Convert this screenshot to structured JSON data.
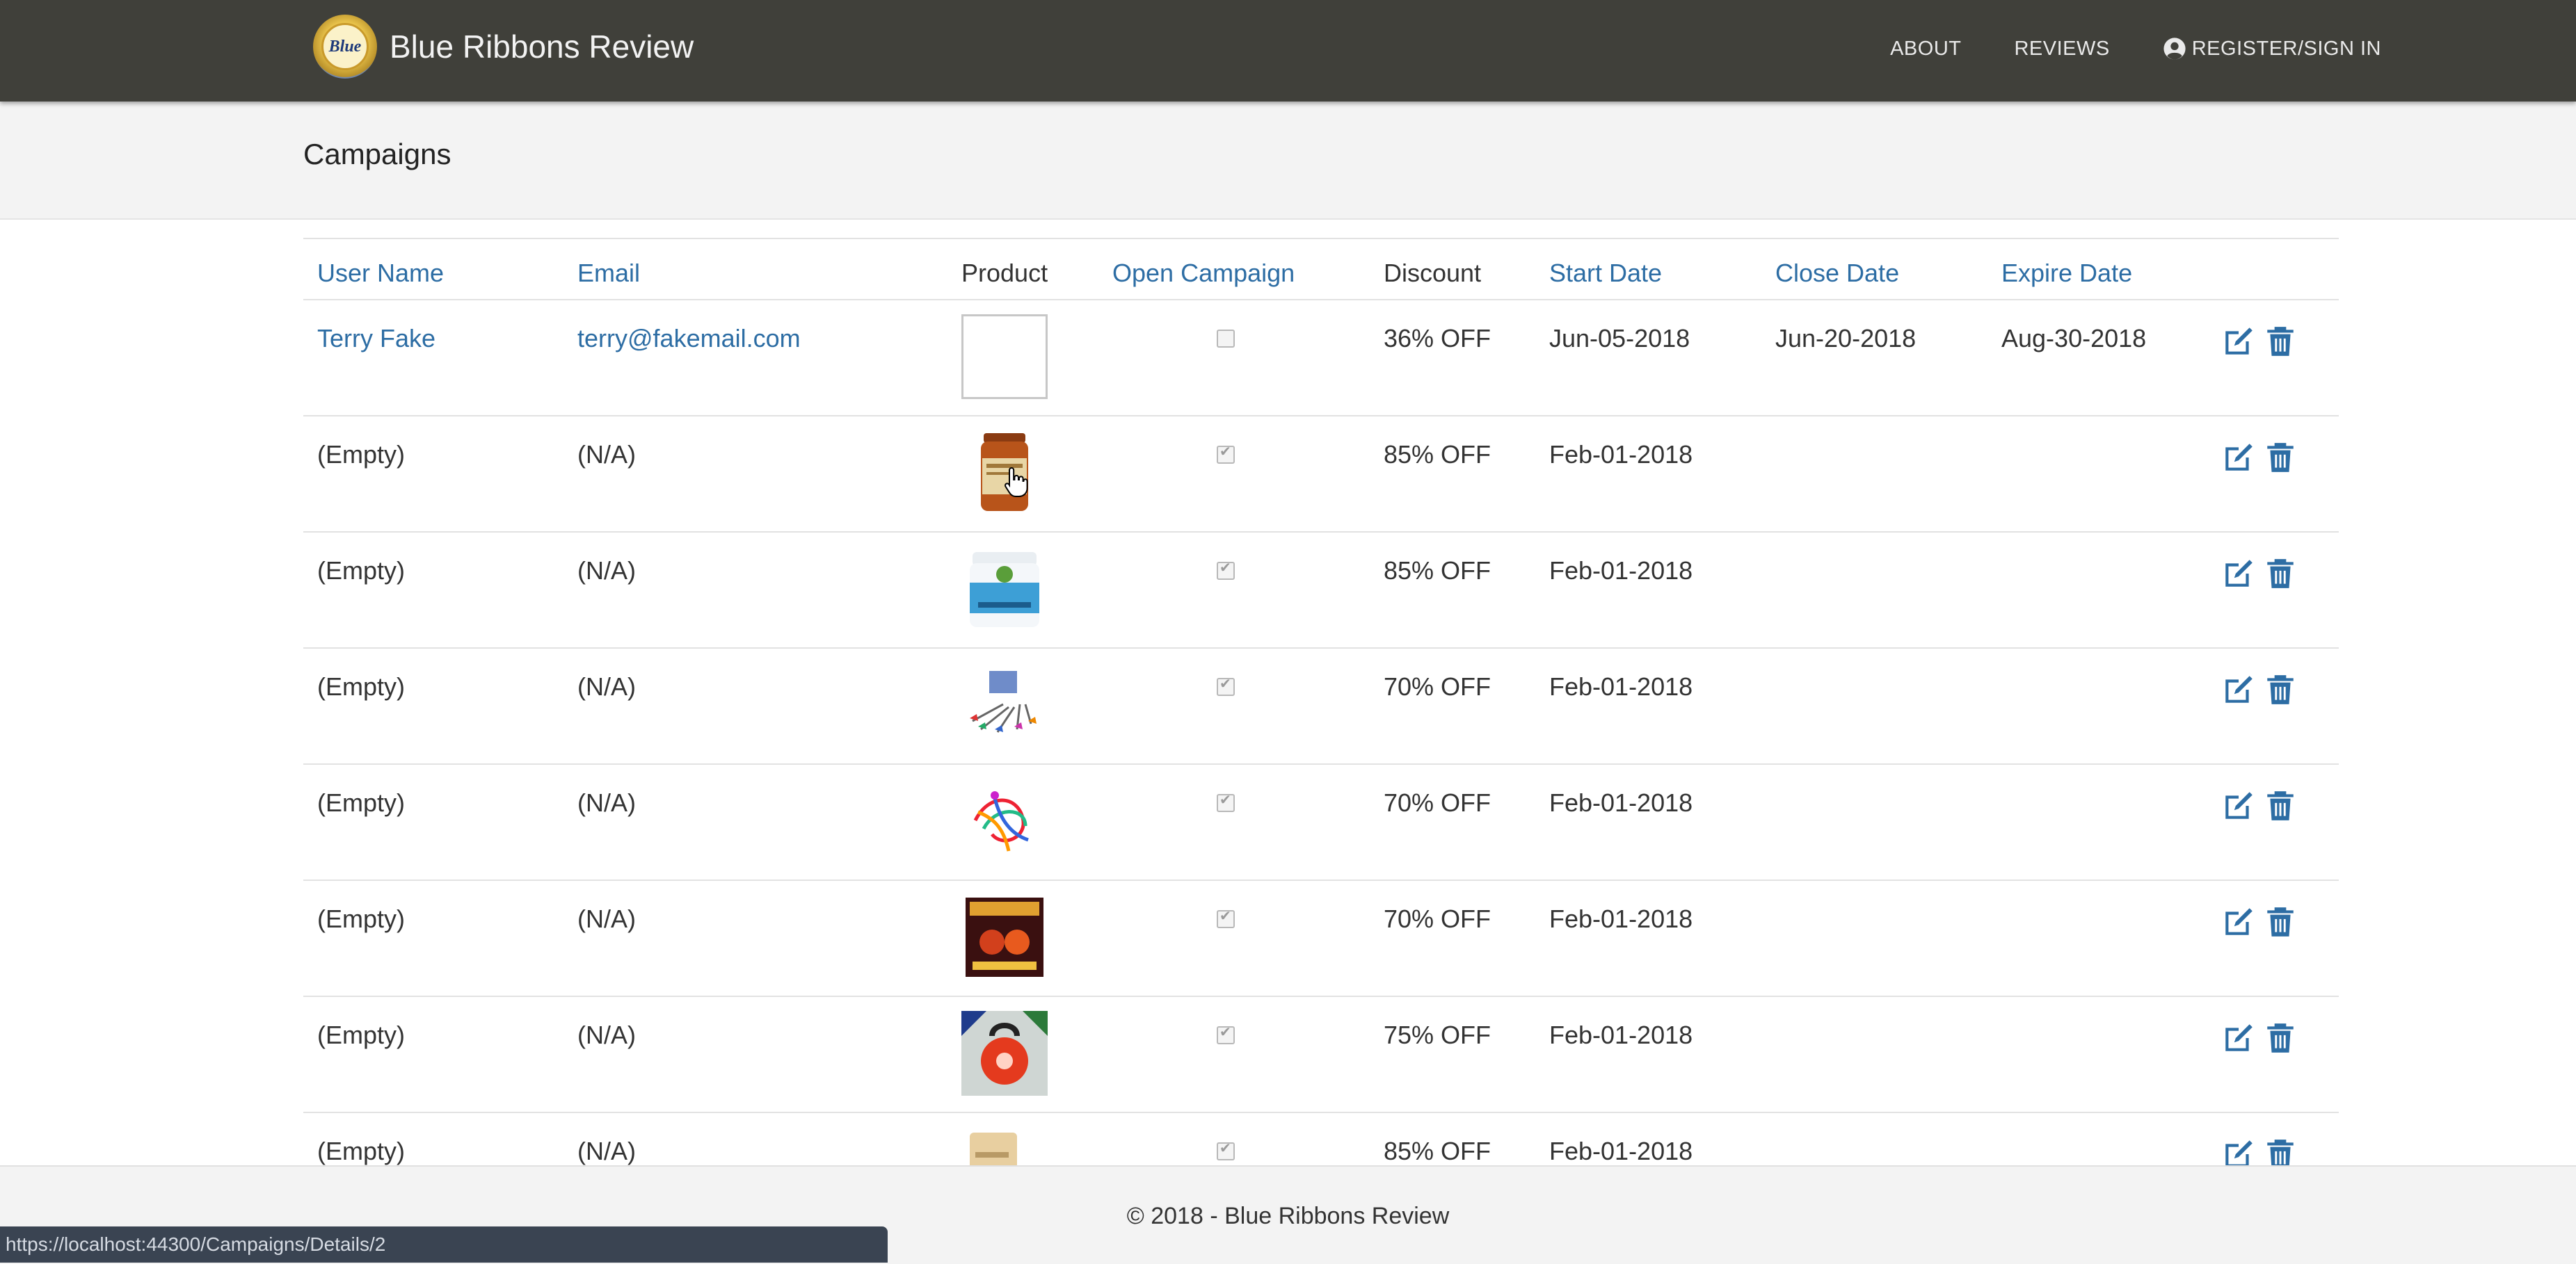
{
  "nav": {
    "brand": "Blue Ribbons Review",
    "logo_text": "Blue",
    "links": [
      "ABOUT",
      "REVIEWS",
      "REGISTER/SIGN IN"
    ]
  },
  "page_title": "Campaigns",
  "table": {
    "headers": [
      "User Name",
      "Email",
      "Product",
      "Open Campaign",
      "Discount",
      "Start Date",
      "Close Date",
      "Expire Date"
    ],
    "rows": [
      {
        "user": "Terry Fake",
        "email": "terry@fakemail.com",
        "product": "broken-image",
        "open": false,
        "discount": "36% OFF",
        "start": "Jun-05-2018",
        "close": "Jun-20-2018",
        "expire": "Aug-30-2018"
      },
      {
        "user": "(Empty)",
        "email": "(N/A)",
        "product": "supplement-bottle",
        "open": true,
        "discount": "85% OFF",
        "start": "Feb-01-2018",
        "close": "",
        "expire": ""
      },
      {
        "user": "(Empty)",
        "email": "(N/A)",
        "product": "probiotic-jar",
        "open": true,
        "discount": "85% OFF",
        "start": "Feb-01-2018",
        "close": "",
        "expire": ""
      },
      {
        "user": "(Empty)",
        "email": "(N/A)",
        "product": "dart-set",
        "open": true,
        "discount": "70% OFF",
        "start": "Feb-01-2018",
        "close": "",
        "expire": ""
      },
      {
        "user": "(Empty)",
        "email": "(N/A)",
        "product": "colorful-cables",
        "open": true,
        "discount": "70% OFF",
        "start": "Feb-01-2018",
        "close": "",
        "expire": ""
      },
      {
        "user": "(Empty)",
        "email": "(N/A)",
        "product": "book-cover",
        "open": true,
        "discount": "70% OFF",
        "start": "Feb-01-2018",
        "close": "",
        "expire": ""
      },
      {
        "user": "(Empty)",
        "email": "(N/A)",
        "product": "kettlebell",
        "open": true,
        "discount": "75% OFF",
        "start": "Feb-01-2018",
        "close": "",
        "expire": ""
      },
      {
        "user": "(Empty)",
        "email": "(N/A)",
        "product": "pouch",
        "open": true,
        "discount": "85% OFF",
        "start": "Feb-01-2018",
        "close": "",
        "expire": ""
      }
    ]
  },
  "footer": {
    "copyright": "© 2018 - Blue Ribbons Review"
  },
  "status_url": "https://localhost:44300/Campaigns/Details/2",
  "colors": {
    "navbar": "#40403a",
    "link": "#2d6da4",
    "jumbo": "#f3f3f3"
  }
}
